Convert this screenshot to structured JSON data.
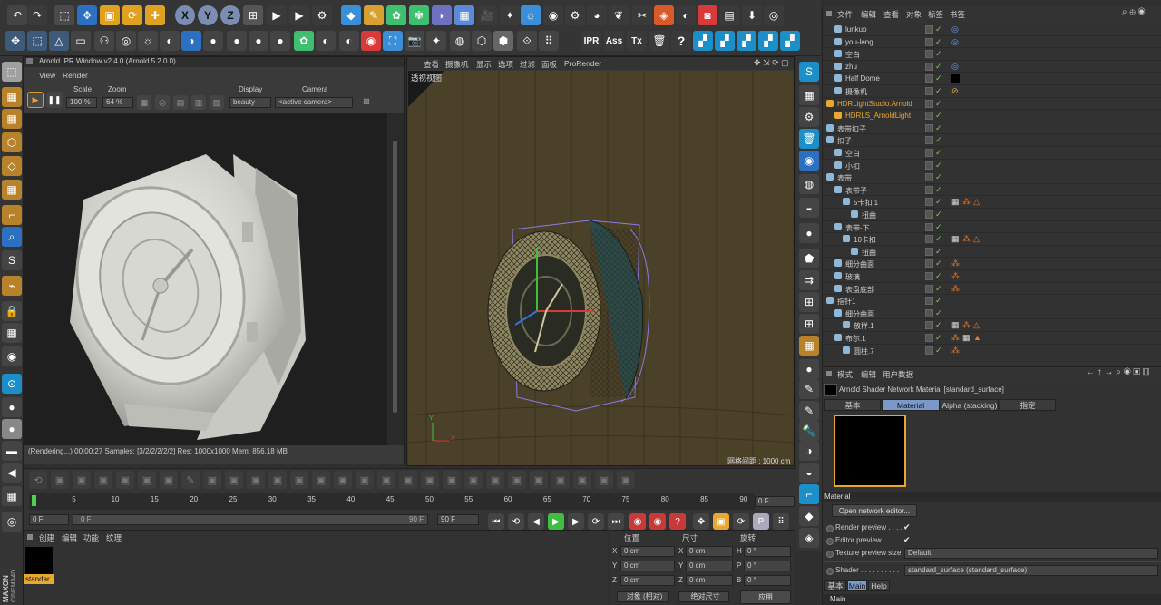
{
  "top_toolbar": {
    "row1": [
      "undo-icon",
      "redo-icon",
      "select-icon",
      "move-icon",
      "scale-icon",
      "rotate-icon",
      "add-icon",
      "x-axis",
      "y-axis",
      "z-axis",
      "coord-icon",
      "render-view-icon",
      "render-picture-icon",
      "render-settings-icon",
      "cube-icon",
      "pen-icon",
      "subdiv-icon",
      "cloner-icon",
      "deformer-icon",
      "floor-icon",
      "camera-icon",
      "light-icon",
      "sky-icon",
      "arnold-light-icon",
      "arnold-gear-icon",
      "arnold-sphere-icon",
      "leaf-icon",
      "tool-icon",
      "shader-icon",
      "ipr-icon",
      "photo-icon",
      "pdf-icon",
      "download-icon",
      "globe-icon"
    ],
    "labels": {
      "x": "X",
      "y": "Y",
      "z": "Z",
      "ipr": "IPR",
      "ass": "Ass",
      "tx": "Tx",
      "help": "?"
    }
  },
  "ipr": {
    "title": "Arnold IPR Window v2.4.0 (Arnold 5.2.0.0)",
    "menu": [
      "View",
      "Render"
    ],
    "scale_label": "Scale",
    "scale_value": "100 %",
    "zoom_label": "Zoom",
    "zoom_value": "64 %",
    "display_label": "Display",
    "display_value": "beauty",
    "camera_label": "Camera",
    "camera_value": "<active camera>",
    "status": "(Rendering...) 00:00:27  Samples: [3/2/2/2/2/2]  Res: 1000x1000  Mem: 856.18 MB"
  },
  "viewport": {
    "menu": [
      "查看",
      "摄像机",
      "显示",
      "选项",
      "过滤",
      "面板",
      "ProRender"
    ],
    "label": "透视视图",
    "grid_info": "网格间距 : 1000 cm",
    "axis_y": "Y",
    "axis_x": "X"
  },
  "object_manager": {
    "menu": [
      "文件",
      "编辑",
      "查看",
      "对象",
      "标签",
      "书签"
    ],
    "rows": [
      {
        "name": "lunkuo",
        "indent": 1,
        "tag": "target"
      },
      {
        "name": "you-leng",
        "indent": 1,
        "tag": "target"
      },
      {
        "name": "空白",
        "indent": 1,
        "tag": ""
      },
      {
        "name": "zhu",
        "indent": 1,
        "tag": "target"
      },
      {
        "name": "Half Dome",
        "indent": 1,
        "tag": "black"
      },
      {
        "name": "摄像机",
        "indent": 1,
        "tag": "protect"
      },
      {
        "name": "HDRLightStudio.Arnold",
        "indent": 0,
        "tag": "",
        "highlight": true
      },
      {
        "name": "HDRLS_ArnoldLight",
        "indent": 1,
        "tag": "",
        "highlight": true
      },
      {
        "name": "表带扣子",
        "indent": 0,
        "tag": ""
      },
      {
        "name": "扣子",
        "indent": 0,
        "tag": ""
      },
      {
        "name": "空白",
        "indent": 1,
        "tag": ""
      },
      {
        "name": "小扣",
        "indent": 1,
        "tag": ""
      },
      {
        "name": "表带",
        "indent": 0,
        "tag": ""
      },
      {
        "name": "表带子",
        "indent": 1,
        "tag": ""
      },
      {
        "name": "5卡扣.1",
        "indent": 2,
        "tag": "checker-tri"
      },
      {
        "name": "扭曲",
        "indent": 3,
        "tag": ""
      },
      {
        "name": "表带-下",
        "indent": 1,
        "tag": ""
      },
      {
        "name": "10卡扣",
        "indent": 2,
        "tag": "checker-tri"
      },
      {
        "name": "扭曲",
        "indent": 3,
        "tag": ""
      },
      {
        "name": "细分曲面",
        "indent": 1,
        "tag": "mat"
      },
      {
        "name": "玻璃",
        "indent": 1,
        "tag": "mat"
      },
      {
        "name": "表盘底部",
        "indent": 1,
        "tag": "mat"
      },
      {
        "name": "指针1",
        "indent": 0,
        "tag": ""
      },
      {
        "name": "细分曲面",
        "indent": 1,
        "tag": ""
      },
      {
        "name": "放样.1",
        "indent": 2,
        "tag": "checker-tri"
      },
      {
        "name": "布尔.1",
        "indent": 1,
        "tag": "mat-checker-tri"
      },
      {
        "name": "圆柱.7",
        "indent": 2,
        "tag": "mat"
      }
    ]
  },
  "attribute_manager": {
    "menu": [
      "模式",
      "编辑",
      "用户数据"
    ],
    "title": "Arnold Shader Network Material [standard_surface]",
    "tabs": [
      "基本",
      "Material",
      "Alpha (stacking)",
      "指定"
    ],
    "section_material": "Material",
    "open_network_editor": "Open network editor...",
    "render_preview_label": "Render preview . . . . .",
    "editor_preview_label": "Editor preview. . . . . .",
    "texture_preview_label": "Texture preview size",
    "texture_preview_value": "Default",
    "shader_label": "Shader . . . . . . . . . .",
    "shader_value": "standard_surface (standard_surface)",
    "bottom_tabs": [
      "基本",
      "Main",
      "Help"
    ],
    "section_main": "Main",
    "check": "✔"
  },
  "animation": {
    "ticks": [
      "0",
      "5",
      "10",
      "15",
      "20",
      "25",
      "30",
      "35",
      "40",
      "45",
      "50",
      "55",
      "60",
      "65",
      "70",
      "75",
      "80",
      "85",
      "90"
    ],
    "current_frame": "0 F",
    "start_frame": "0 F",
    "range_start": "0 F",
    "range_end": "90 F",
    "end_frame": "90 F"
  },
  "material_manager": {
    "menu": [
      "创建",
      "编辑",
      "功能",
      "纹理"
    ],
    "material_name": "standar"
  },
  "coordinates": {
    "headers": [
      "位置",
      "尺寸",
      "旋转"
    ],
    "rows": [
      {
        "axis": "X",
        "pos": "0 cm",
        "size_axis": "X",
        "size": "0 cm",
        "rot_axis": "H",
        "rot": "0 °"
      },
      {
        "axis": "Y",
        "pos": "0 cm",
        "size_axis": "Y",
        "size": "0 cm",
        "rot_axis": "P",
        "rot": "0 °"
      },
      {
        "axis": "Z",
        "pos": "0 cm",
        "size_axis": "Z",
        "size": "0 cm",
        "rot_axis": "B",
        "rot": "0 °"
      }
    ],
    "mode1": "对象 (相对)",
    "mode2": "绝对尺寸",
    "apply": "应用"
  },
  "branding": {
    "maxon": "MAXON",
    "cinema": "CINEMA4D"
  },
  "colors": {
    "accent_blue": "#5ea0d8",
    "highlight_orange": "#e8a830",
    "check_green": "#7dc85a",
    "active_tab": "#7a98c8"
  }
}
